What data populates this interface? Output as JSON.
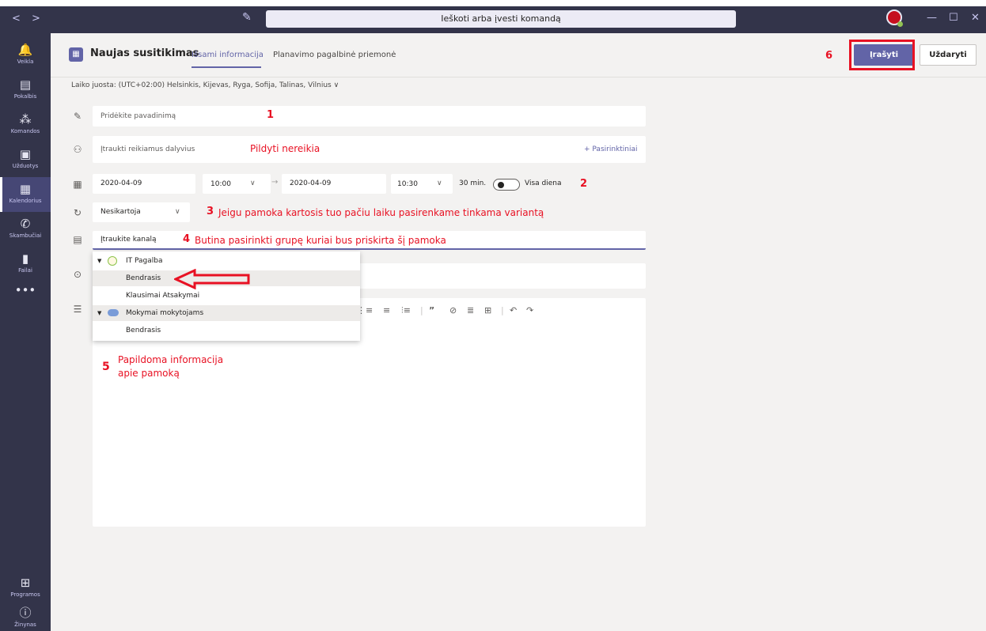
{
  "topbar": {
    "nav_back": "<",
    "nav_forward": ">",
    "search_placeholder": "Ieškoti arba įvesti komandą",
    "minimize": "—",
    "maximize": "☐",
    "close": "✕"
  },
  "rail": {
    "items": [
      {
        "label": "Veikla",
        "icon": "bell-icon",
        "glyph": "🔔"
      },
      {
        "label": "Pokalbis",
        "icon": "chat-icon",
        "glyph": "▤"
      },
      {
        "label": "Komandos",
        "icon": "teams-icon",
        "glyph": "⁂"
      },
      {
        "label": "Užduotys",
        "icon": "assignments-icon",
        "glyph": "▣"
      },
      {
        "label": "Kalendorius",
        "icon": "calendar-icon",
        "glyph": "▦"
      },
      {
        "label": "Skambučiai",
        "icon": "phone-icon",
        "glyph": "✆"
      },
      {
        "label": "Failai",
        "icon": "files-icon",
        "glyph": "▮"
      },
      {
        "label": "...",
        "icon": "more-icon",
        "glyph": "•••"
      }
    ],
    "apps_label": "Programos",
    "help_label": "Žinynas"
  },
  "header": {
    "title": "Naujas susitikimas",
    "tab_details": "Išsami informacija",
    "tab_assistant": "Planavimo pagalbinė priemonė",
    "save": "Įrašyti",
    "close": "Uždaryti",
    "timezone": "Laiko juosta: (UTC+02:00) Helsinkis, Kijevas, Ryga, Sofija, Talinas, Vilnius ∨"
  },
  "form": {
    "title_placeholder": "Pridėkite pavadinimą",
    "attendees_placeholder": "Įtraukti reikiamus dalyvius",
    "optional_label": "+ Pasirinktiniai",
    "start_date": "2020-04-09",
    "start_time": "10:00",
    "end_date": "2020-04-09",
    "end_time": "10:30",
    "duration": "30 min.",
    "all_day": "Visa diena",
    "repeat": "Nesikartoja",
    "channel_placeholder": "Įtraukite kanalą"
  },
  "dropdown": {
    "groups": [
      {
        "name": "IT Pagalba",
        "channels": [
          "Bendrasis",
          "Klausimai Atsakymai"
        ]
      },
      {
        "name": "Mokymai mokytojams",
        "channels": [
          "Bendrasis"
        ]
      }
    ]
  },
  "annotations": {
    "n1": "1",
    "n2": "2",
    "n3": "3",
    "n3_text": "Jeigu pamoka kartosis tuo pačiu laiku pasirenkame tinkama variantą",
    "n4": "4",
    "n4_text": "Butina pasirinkti grupę kuriai bus priskirta šį pamoka",
    "n5": "5",
    "n5_text1": "Papildoma informacija",
    "n5_text2": "apie pamoką",
    "n6": "6",
    "no_need": "Pildyti nereikia"
  },
  "colors": {
    "accent": "#6264a7",
    "annotation": "#e81123",
    "rail": "#33344a"
  }
}
